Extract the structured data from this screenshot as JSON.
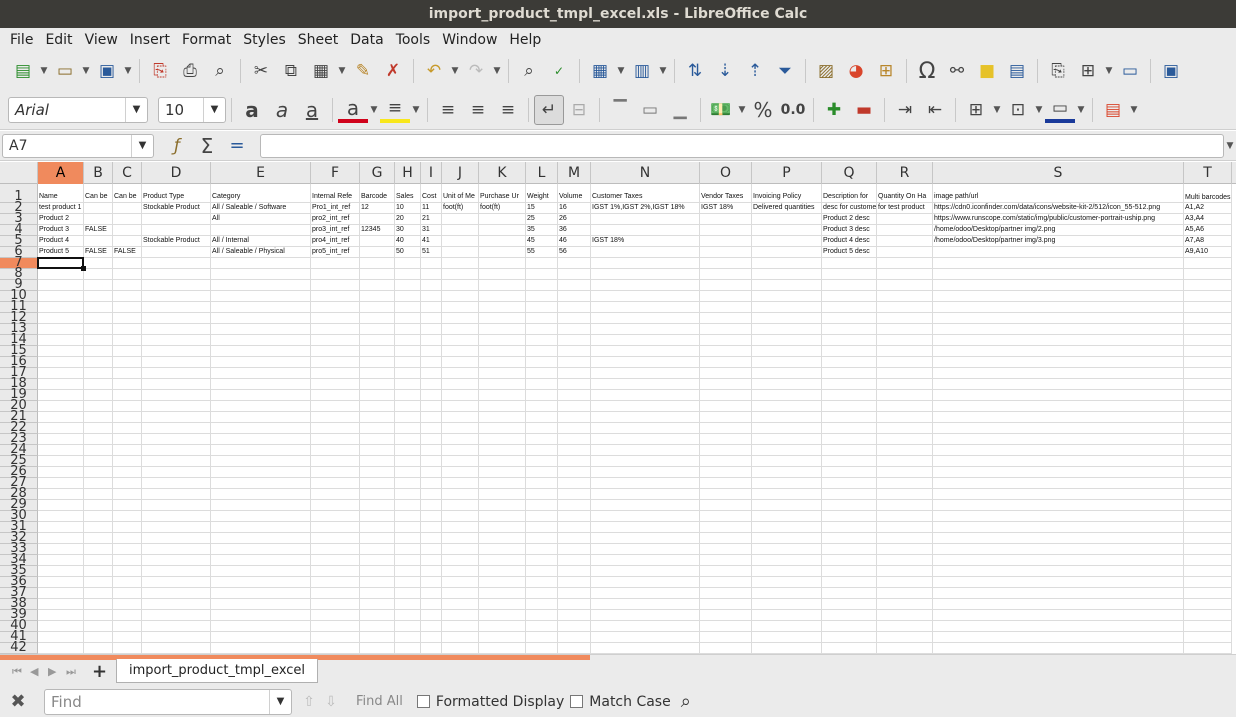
{
  "window": {
    "title": "import_product_tmpl_excel.xls - LibreOffice Calc"
  },
  "menu": [
    "File",
    "Edit",
    "View",
    "Insert",
    "Format",
    "Styles",
    "Sheet",
    "Data",
    "Tools",
    "Window",
    "Help"
  ],
  "toolbar1": {
    "icons": [
      "new-icon",
      "open-icon",
      "save-icon",
      "export-pdf-icon",
      "print-icon",
      "print-preview-icon",
      "cut-icon",
      "copy-icon",
      "paste-icon",
      "clone-formatting-icon",
      "clear-formatting-icon",
      "undo-icon",
      "redo-icon",
      "find-replace-icon",
      "spelling-icon",
      "row-icon",
      "column-icon",
      "sort-icon",
      "sort-ascending-icon",
      "sort-descending-icon",
      "autofilter-icon",
      "image-icon",
      "chart-icon",
      "pivot-table-icon",
      "special-character-icon",
      "hyperlink-icon",
      "comment-icon",
      "headers-footers-icon",
      "define-print-area-icon",
      "freeze-rows-columns-icon",
      "split-window-icon",
      "show-draw-functions-icon"
    ]
  },
  "toolbar2": {
    "font_name": "Arial",
    "font_size": "10",
    "percent_glyph": "%",
    "number_glyph": "0.0"
  },
  "formula_bar": {
    "name_box": "A7",
    "content": ""
  },
  "grid": {
    "columns": [
      "A",
      "B",
      "C",
      "D",
      "E",
      "F",
      "G",
      "H",
      "I",
      "J",
      "K",
      "L",
      "M",
      "N",
      "O",
      "P",
      "Q",
      "R",
      "S",
      "T"
    ],
    "selected_column": "A",
    "selected_row": 7,
    "row_numbers": [
      1,
      2,
      3,
      4,
      5,
      6,
      7,
      8,
      9,
      10,
      11,
      12,
      13,
      14,
      15,
      16,
      17,
      18,
      19,
      20,
      21,
      22,
      23,
      24,
      25,
      26,
      27,
      28,
      29,
      30,
      31,
      32,
      33,
      34,
      35,
      36,
      37,
      38,
      39,
      40,
      41,
      42
    ],
    "headers": [
      "Name",
      "Can be",
      "Can be",
      "Product Type",
      "Category",
      "Internal Refe",
      "Barcode",
      "Sales",
      "Cost",
      "Unit of Me",
      "Purchase Ur",
      "Weight",
      "Volume",
      "Customer Taxes",
      "Vendor Taxes",
      "Invoicing Policy",
      "Description for",
      "Quantity On Ha",
      "image path/url",
      "Multi barcodes"
    ],
    "rows": [
      [
        "test product 1",
        "",
        "",
        "Stockable Product",
        "All / Saleable / Software",
        "Pro1_int_ref",
        "12",
        "10",
        "11",
        "foot(ft)",
        "foot(ft)",
        "15",
        "16",
        "IGST 1%,IGST 2%,IGST 18%",
        "IGST 18%",
        "Delivered quantities",
        "desc for customer",
        "for test product",
        "https://cdn0.iconfinder.com/data/icons/website-kit-2/512/icon_55-512.png",
        "A1,A2"
      ],
      [
        "Product 2",
        "",
        "",
        "",
        "All",
        "pro2_int_ref",
        "",
        "20",
        "21",
        "",
        "",
        "25",
        "26",
        "",
        "",
        "",
        "Product 2 desc",
        "",
        "https://www.runscope.com/static/img/public/customer-portrait-uship.png",
        "A3,A4"
      ],
      [
        "Product 3",
        "FALSE",
        "",
        "",
        "",
        "pro3_int_ref",
        "12345",
        "30",
        "31",
        "",
        "",
        "35",
        "36",
        "",
        "",
        "",
        "Product 3 desc",
        "",
        "/home/odoo/Desktop/partner img/2.png",
        "A5,A6"
      ],
      [
        "Product 4",
        "",
        "",
        "Stockable Product",
        "All / Internal",
        "pro4_int_ref",
        "",
        "40",
        "41",
        "",
        "",
        "45",
        "46",
        "IGST 18%",
        "",
        "",
        "Product 4 desc",
        "",
        "/home/odoo/Desktop/partner img/3.png",
        "A7,A8"
      ],
      [
        "Product 5",
        "FALSE",
        "FALSE",
        "",
        "All / Saleable / Physical",
        "pro5_int_ref",
        "",
        "50",
        "51",
        "",
        "",
        "55",
        "56",
        "",
        "",
        "",
        "Product 5 desc",
        "",
        "",
        "A9,A10"
      ]
    ]
  },
  "sheet_tabs": [
    "import_product_tmpl_excel"
  ],
  "find_bar": {
    "placeholder": "Find",
    "find_all": "Find All",
    "formatted_display": "Formatted Display",
    "match_case": "Match Case"
  },
  "colors": {
    "accent": "#f08a5d",
    "titlebar": "#3c3b37",
    "chrome": "#ebebeb"
  }
}
